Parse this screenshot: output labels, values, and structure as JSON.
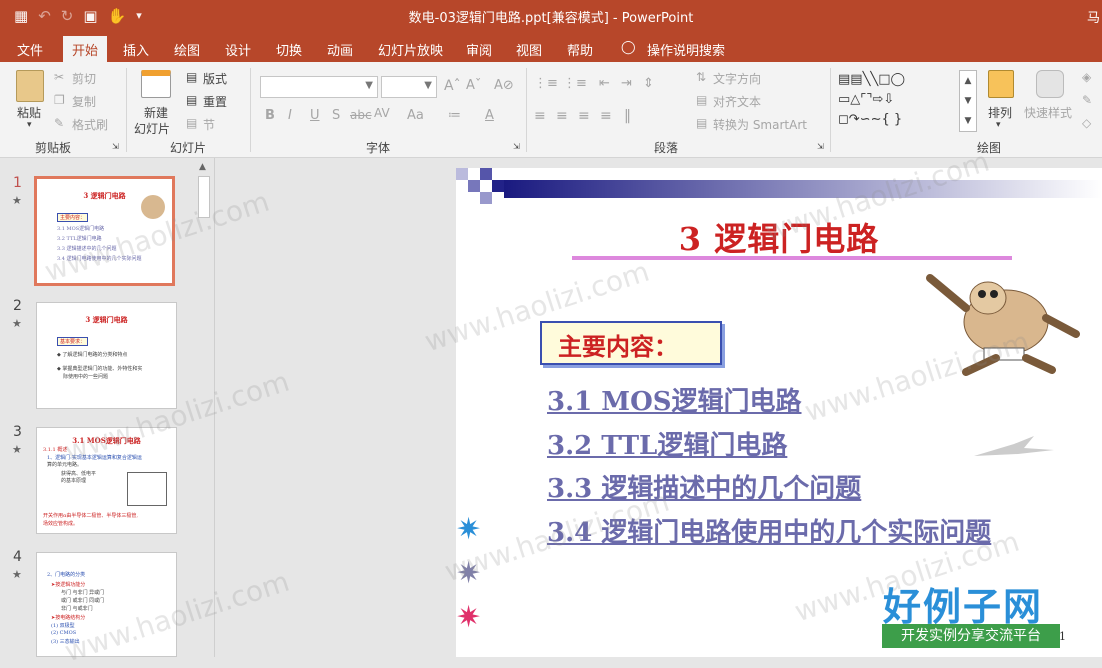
{
  "window": {
    "doc_title": "数电-03逻辑门电路.ppt[兼容模式]  -  PowerPoint",
    "user": "马"
  },
  "qat": {
    "save_icon": "save-icon",
    "undo_icon": "undo-icon",
    "redo_icon": "redo-icon"
  },
  "menu": {
    "items": [
      "文件",
      "开始",
      "插入",
      "绘图",
      "设计",
      "切换",
      "动画",
      "幻灯片放映",
      "审阅",
      "视图",
      "帮助"
    ],
    "tell_me": "操作说明搜索"
  },
  "ribbon": {
    "clipboard": {
      "paste": "粘贴",
      "cut": "剪切",
      "copy": "复制",
      "format_painter": "格式刷",
      "label": "剪贴板"
    },
    "slides": {
      "new_slide_1": "新建",
      "new_slide_2": "幻灯片",
      "layout": "版式",
      "reset": "重置",
      "section": "节",
      "label": "幻灯片"
    },
    "font": {
      "bold": "B",
      "italic": "I",
      "underline": "U",
      "strike": "S",
      "abc": "abc",
      "spacing": "AV",
      "case": "Aa",
      "label": "字体"
    },
    "paragraph": {
      "text_direction": "文字方向",
      "align_text": "对齐文本",
      "smartart": "转换为 SmartArt",
      "label": "段落"
    },
    "drawing": {
      "arrange": "排列",
      "quick_styles": "快速样式",
      "label": "绘图"
    }
  },
  "thumbnails": [
    {
      "num": "1",
      "title": "3 逻辑门电路",
      "lines": [
        "主要内容：",
        "3.1  MOS逻辑门电路",
        "3.2  TTL逻辑门电路",
        "3.3 逻辑描述中的几个问题",
        "3.4 逻辑门电路使用中的几个实际问题"
      ]
    },
    {
      "num": "2",
      "title": "3 逻辑门电路",
      "lines": [
        "基本要求：",
        "◆ 了解逻辑门电路的分类和特点",
        "◆ 掌握典型逻辑门的功能、外特性和实",
        "际使用中的一些问题"
      ]
    },
    {
      "num": "3",
      "title": "3.1  MOS逻辑门电路",
      "lines": [
        "3.1.1  概述",
        "1、逻辑门:实现基本逻辑运算和复合逻辑运",
        "算的单元电路。",
        "获得高、低电平",
        "的基本原理",
        "开关作用α由半导体二极管、半导体三极管,",
        "场效应管构成。"
      ]
    },
    {
      "num": "4",
      "title": "",
      "lines": [
        "2、门电路的分类",
        "➤按逻辑功能分",
        "与门      与非门      异或门",
        "或门      或非门      同或门",
        "非门      与或非门",
        "➤按电路结构分",
        "(1) 双极型",
        "(2) CMOS",
        "(3) 三态输出"
      ]
    }
  ],
  "slide": {
    "title": "3   逻辑门电路",
    "subheading": "主要内容：",
    "toc": [
      "3.1  MOS逻辑门电路",
      "3.2  TTL逻辑门电路",
      "3.3  逻辑描述中的几个问题",
      "3.4  逻辑门电路使用中的几个实际问题"
    ],
    "page_number": "1"
  },
  "watermark": {
    "text": "www.haolizi.com",
    "brand": "好例子网",
    "brand_sub": "开发实例分享交流平台"
  },
  "colors": {
    "accent": "#b7472a",
    "slide_title": "#cc2222",
    "toc_link": "#6b6bab"
  }
}
